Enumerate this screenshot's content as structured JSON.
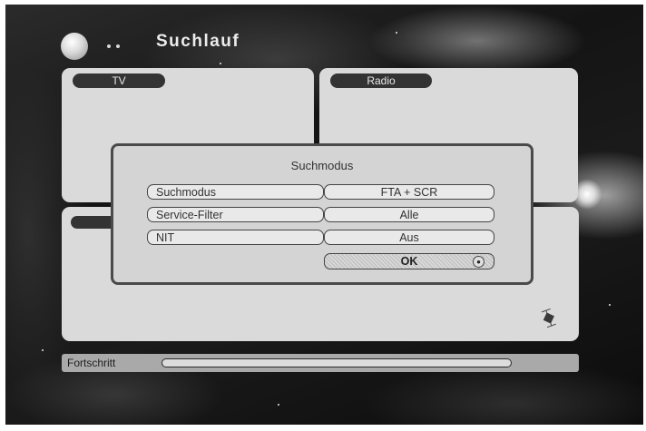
{
  "header": {
    "title": "Suchlauf",
    "icon": "globe-icon"
  },
  "panels": {
    "tv_label": "TV",
    "radio_label": "Radio",
    "satellite_icon": "satellite-icon",
    "satellite_glyph": "⧱"
  },
  "dialog": {
    "title": "Suchmodus",
    "rows": [
      {
        "label": "Suchmodus",
        "value": "FTA + SCR"
      },
      {
        "label": "Service-Filter",
        "value": "Alle"
      },
      {
        "label": "NIT",
        "value": "Aus"
      }
    ],
    "ok_label": "OK",
    "ok_icon": "ok-remote-icon",
    "ok_icon_glyph": "●"
  },
  "progress": {
    "label": "Fortschritt",
    "value_fraction": 0.0
  }
}
